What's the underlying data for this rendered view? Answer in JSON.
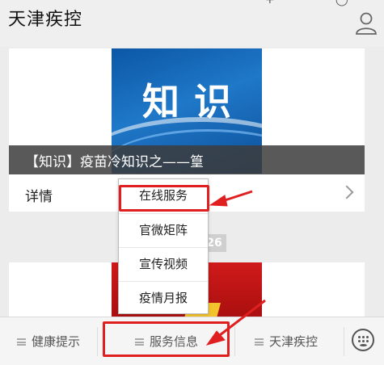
{
  "header": {
    "title": "天津疾控",
    "top_icons": [
      "+",
      "◯"
    ],
    "profile_icon": "person-icon"
  },
  "article": {
    "cover_text": "知识",
    "caption": "【知识】疫苗冷知识之——篁",
    "detail_label": "详情"
  },
  "date_badge": "26",
  "popup_menu": {
    "items": [
      "在线服务",
      "官微矩阵",
      "宣传视频",
      "疫情月报"
    ]
  },
  "bottom_nav": {
    "tabs": [
      "健康提示",
      "服务信息",
      "天津疾控"
    ],
    "keyboard_icon": "keyboard-icon"
  },
  "annotations": {
    "color": "#e02020",
    "highlighted": [
      "在线服务",
      "服务信息"
    ]
  }
}
